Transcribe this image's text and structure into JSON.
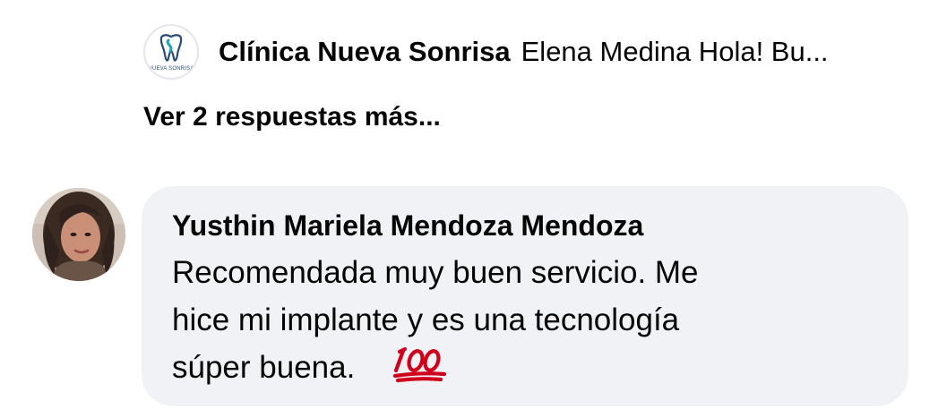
{
  "reply": {
    "author": "Clínica Nueva Sonrisa",
    "snippet": "Elena Medina Hola! Bu...",
    "avatar_icon": "clinic-logo-icon",
    "avatar_text": "NUEVA SONRISA"
  },
  "more_replies": {
    "label": "Ver 2 respuestas más..."
  },
  "comment": {
    "author": "Yusthin Mariela Mendoza Mendoza",
    "lines": [
      "Recomendada muy buen servicio. Me",
      "hice mi implante y es una tecnología",
      "súper buena."
    ],
    "emoji_icon": "hundred-points-icon",
    "avatar_icon": "user-avatar-photo"
  },
  "colors": {
    "bubble_bg": "#f0f2f5",
    "text": "#050505",
    "emoji_red": "#d0021b",
    "logo_blue": "#2a4a7a",
    "logo_teal": "#1fa6b5"
  }
}
